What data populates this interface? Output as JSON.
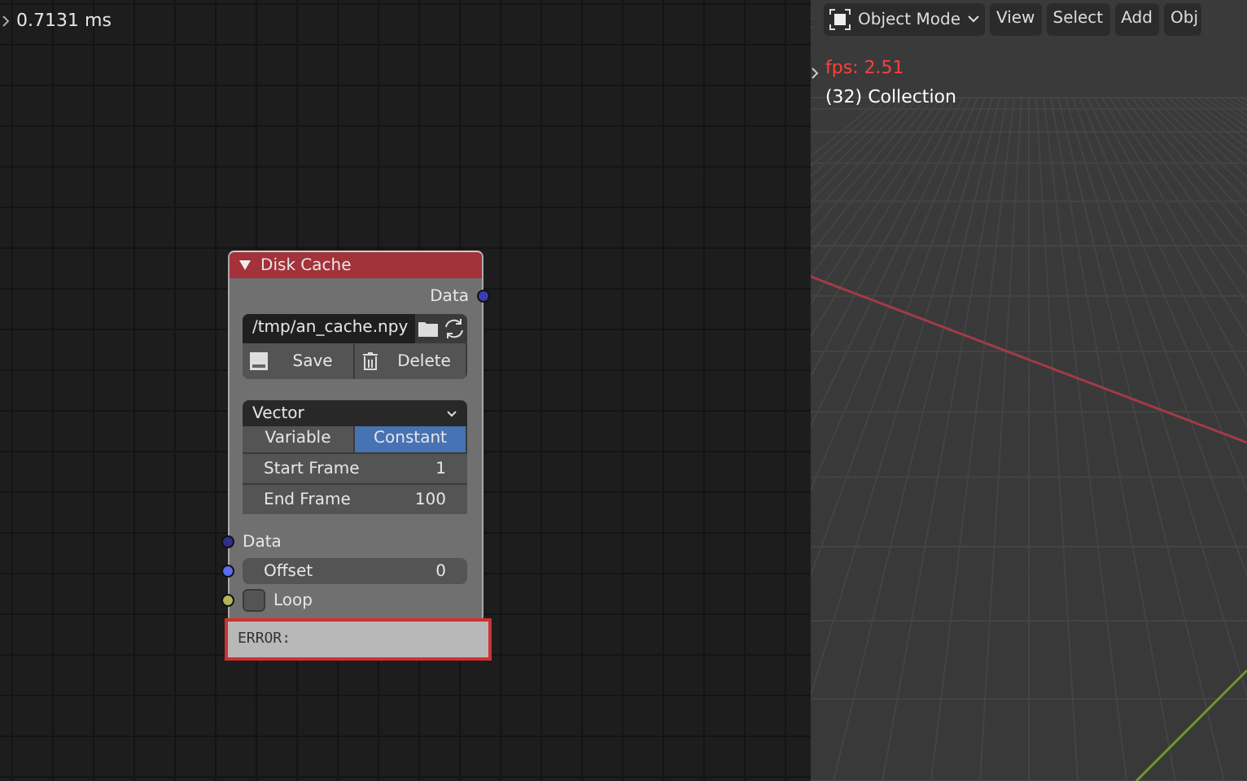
{
  "node_editor": {
    "timing": "0.7131 ms",
    "node": {
      "title": "Disk Cache",
      "expanded": true,
      "outputs": [
        {
          "label": "Data",
          "color": "#3c3cb4"
        }
      ],
      "path": "/tmp/an_cache.npy",
      "buttons": [
        {
          "kind": "save",
          "label": "Save"
        },
        {
          "kind": "delete",
          "label": "Delete"
        }
      ],
      "dropdown": "Vector",
      "options": [
        {
          "label": "Variable",
          "selected": false
        },
        {
          "label": "Constant",
          "selected": true
        }
      ],
      "fields": [
        {
          "label": "Start Frame",
          "value": "1"
        },
        {
          "label": "End Frame",
          "value": "100"
        }
      ],
      "inputs": [
        {
          "kind": "socket",
          "label": "Data",
          "color": "#2f2f8c"
        },
        {
          "kind": "number",
          "label": "Offset",
          "value": "0",
          "color": "#5a6cf0"
        },
        {
          "kind": "checkbox",
          "label": "Loop",
          "checked": false,
          "color": "#b4b45a"
        }
      ],
      "error": "ERROR:"
    }
  },
  "viewport": {
    "mode": "Object Mode",
    "menus": [
      "View",
      "Select",
      "Add",
      "Obj"
    ],
    "fps": "fps: 2.51",
    "collection": "(32) Collection"
  }
}
